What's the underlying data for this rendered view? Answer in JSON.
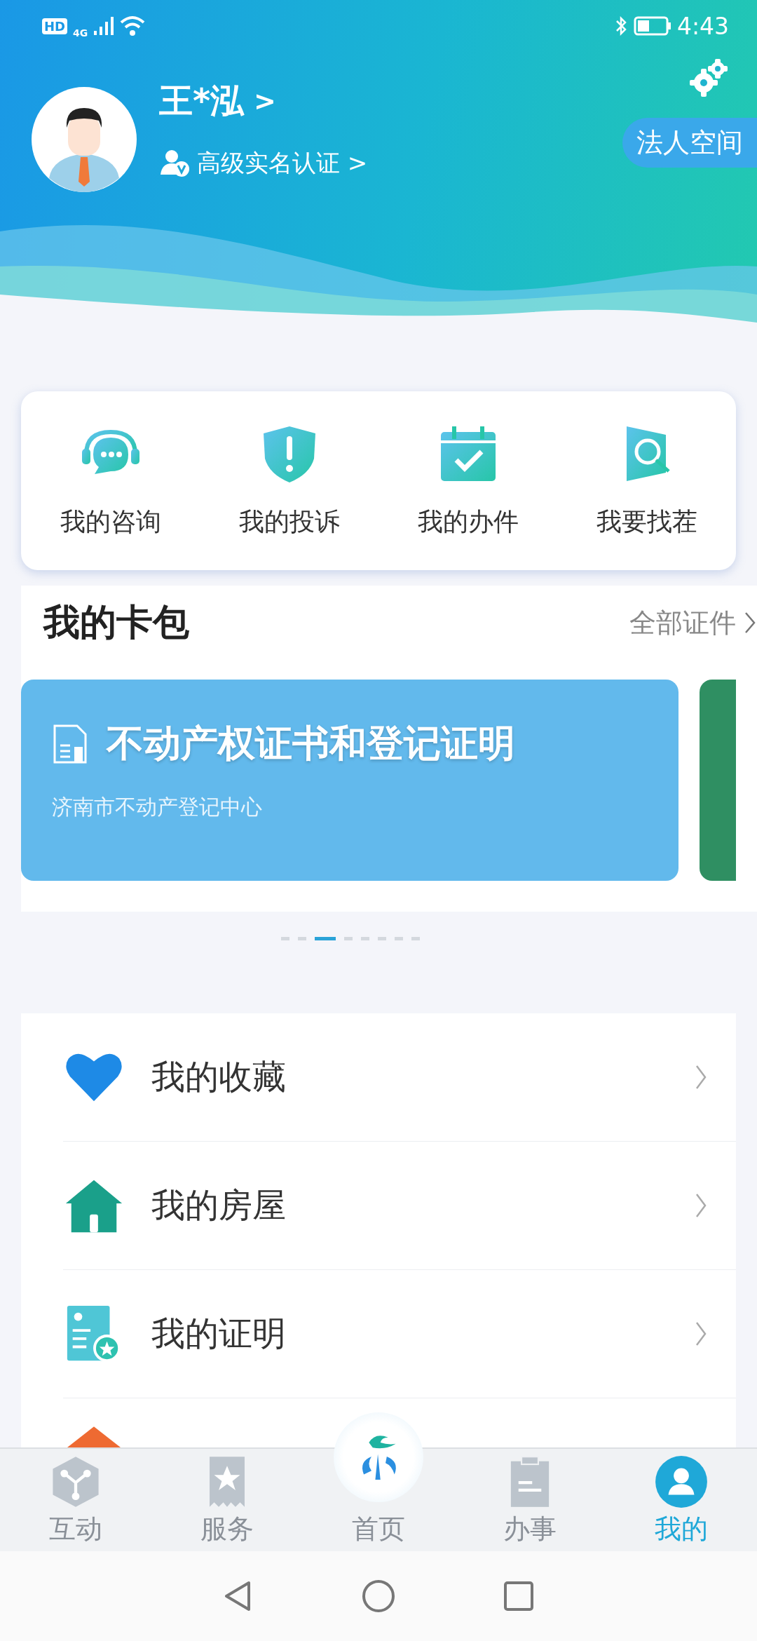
{
  "status_bar": {
    "hd": "HD",
    "network": "4G",
    "time": "4:43"
  },
  "profile": {
    "name": "王*泓",
    "name_arrow": ">",
    "verification": "高级实名认证 >",
    "legal_space": "法人空间"
  },
  "quick_actions": [
    {
      "kind": "consult",
      "label": "我的咨询"
    },
    {
      "kind": "complaint",
      "label": "我的投诉"
    },
    {
      "kind": "tasks",
      "label": "我的办件"
    },
    {
      "kind": "search",
      "label": "我要找茬"
    }
  ],
  "card_pack": {
    "title": "我的卡包",
    "all_link": "全部证件",
    "cards": [
      {
        "title": "不动产权证书和登记证明",
        "issuer": "济南市不动产登记中心",
        "color": "#62b9ec"
      },
      {
        "color": "#2f8f62"
      }
    ],
    "pager": [
      {
        "selected": false
      },
      {
        "selected": false
      },
      {
        "selected": true
      },
      {
        "selected": false
      },
      {
        "selected": false
      },
      {
        "selected": false
      },
      {
        "selected": false
      },
      {
        "selected": false
      }
    ]
  },
  "menu": [
    {
      "kind": "heart",
      "label": "我的收藏"
    },
    {
      "kind": "house",
      "label": "我的房屋"
    },
    {
      "kind": "certificate",
      "label": "我的证明"
    },
    {
      "kind": "home-partial"
    }
  ],
  "tab_bar": [
    {
      "kind": "interact",
      "label": "互动",
      "selected": false
    },
    {
      "kind": "service",
      "label": "服务",
      "selected": false
    },
    {
      "kind": "home",
      "label": "首页",
      "selected": false
    },
    {
      "kind": "affairs",
      "label": "办事",
      "selected": false
    },
    {
      "kind": "mine",
      "label": "我的",
      "selected": true
    }
  ]
}
